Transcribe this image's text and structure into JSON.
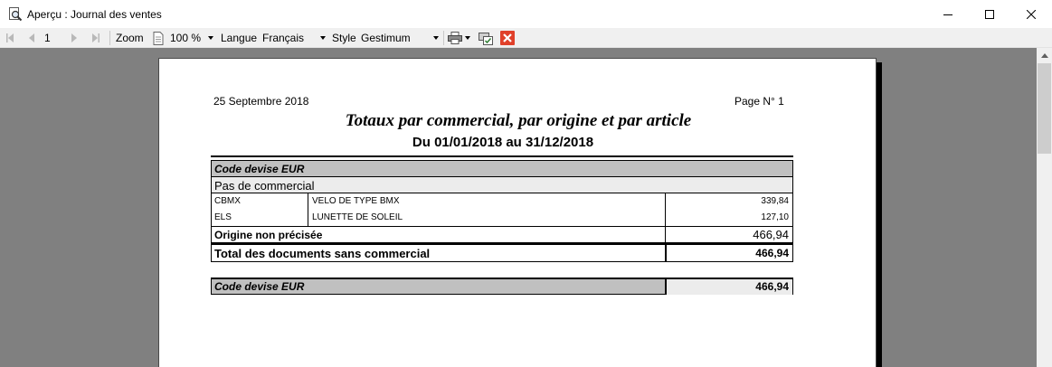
{
  "window": {
    "title": "Aperçu : Journal des ventes"
  },
  "toolbar": {
    "page_number": "1",
    "zoom_label": "Zoom",
    "zoom_value": "100 %",
    "language_label": "Langue",
    "language_value": "Français",
    "style_label": "Style",
    "style_value": "Gestimum"
  },
  "report": {
    "date": "25 Septembre 2018",
    "page": "Page N° 1",
    "title": "Totaux par commercial, par origine et par article",
    "subtitle": "Du 01/01/2018 au 31/12/2018",
    "currency_header": "Code devise EUR",
    "commercial_header": "Pas de commercial",
    "rows": [
      {
        "code": "CBMX",
        "description": "VELO DE TYPE BMX",
        "amount": "339,84"
      },
      {
        "code": "ELS",
        "description": "LUNETTE DE SOLEIL",
        "amount": "127,10"
      }
    ],
    "origin_label": "Origine non précisée",
    "origin_total": "466,94",
    "commercial_total_label": "Total des documents sans commercial",
    "commercial_total": "466,94",
    "currency_total_label": "Code devise EUR",
    "currency_total": "466,94"
  },
  "colors": {
    "header_gray": "#c0c0c0",
    "subheader_gray": "#ececec",
    "workarea_gray": "#808080",
    "close_red": "#e0402a"
  }
}
